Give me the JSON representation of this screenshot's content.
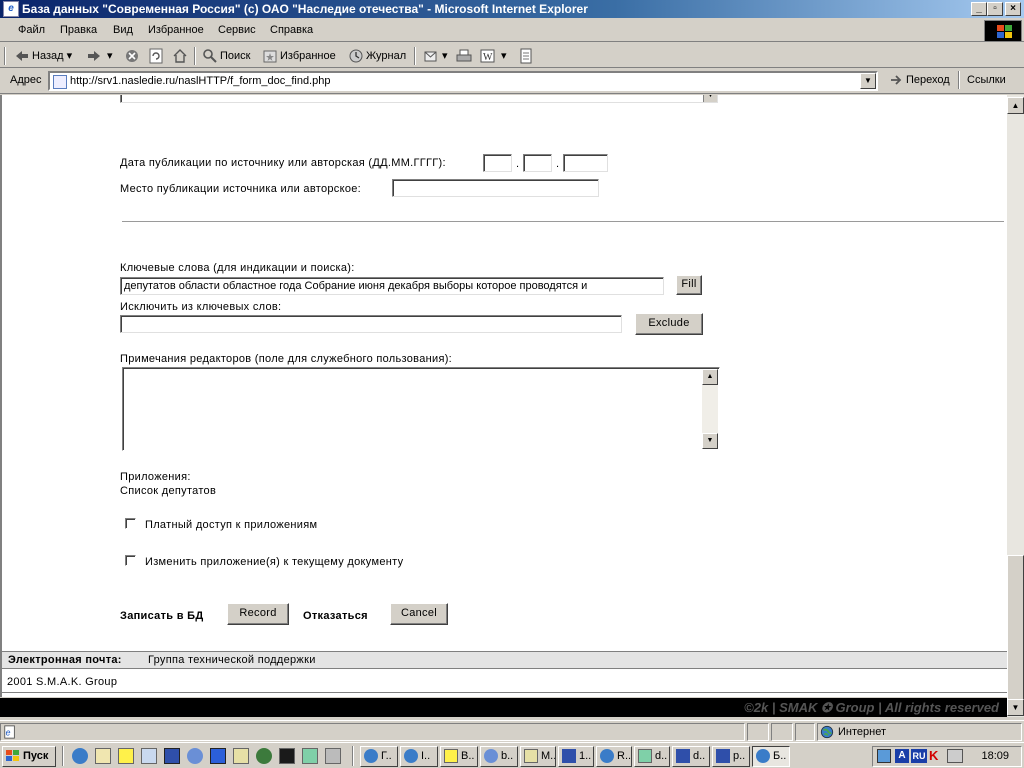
{
  "window": {
    "title": "База данных \"Современная Россия\" (с) ОАО \"Наследие отечества\" - Microsoft Internet Explorer",
    "min": "_",
    "max": "▫",
    "close": "×"
  },
  "menu": [
    "Файл",
    "Правка",
    "Вид",
    "Избранное",
    "Сервис",
    "Справка"
  ],
  "toolbar": {
    "back": "Назад",
    "search": "Поиск",
    "favorites": "Избранное",
    "history": "Журнал"
  },
  "address": {
    "label": "Адрес",
    "url": "http://srv1.nasledie.ru/naslHTTP/f_form_doc_find.php",
    "go": "Переход",
    "links": "Ссылки"
  },
  "form": {
    "pub_date_label": "Дата публикации по источнику или авторская (ДД.ММ.ГГГГ):",
    "date_sep": ".",
    "pub_place_label": "Место публикации источника или авторское:",
    "keywords_label": "Ключевые слова (для индикации и поиска):",
    "keywords_value": "депутатов области областное года Собрание июня декабря выборы которое проводятся и",
    "fill_button": "Fill",
    "exclude_label": "Исключить из ключевых слов:",
    "exclude_button": "Exclude",
    "notes_label": "Примечания редакторов (поле для служебного пользования):",
    "attachments_label": "Приложения:",
    "attachments_value": "Список депутатов",
    "paid_access_label": "Платный доступ к приложениям",
    "change_attachment_label": "Изменить приложение(я) к текущему документу",
    "save_label": "Записать в БД",
    "record_button": "Record",
    "refuse_label": "Отказаться",
    "cancel_button": "Cancel"
  },
  "footer": {
    "email_label": "Электронная почта:",
    "support_link": "Группа технической поддержки",
    "copyright": "2001 S.M.A.K. Group",
    "rights": "©2k | SMAK ✪ Group | All rights reserved"
  },
  "status": {
    "zone": "Интернет"
  },
  "taskbar": {
    "start": "Пуск",
    "tasks": [
      "Г..",
      "I..",
      "В..",
      "b..",
      "M..",
      "1..",
      "R..",
      "d..",
      "d..",
      "p..",
      "Б.."
    ],
    "lang": "RU",
    "clock": "18:09"
  }
}
